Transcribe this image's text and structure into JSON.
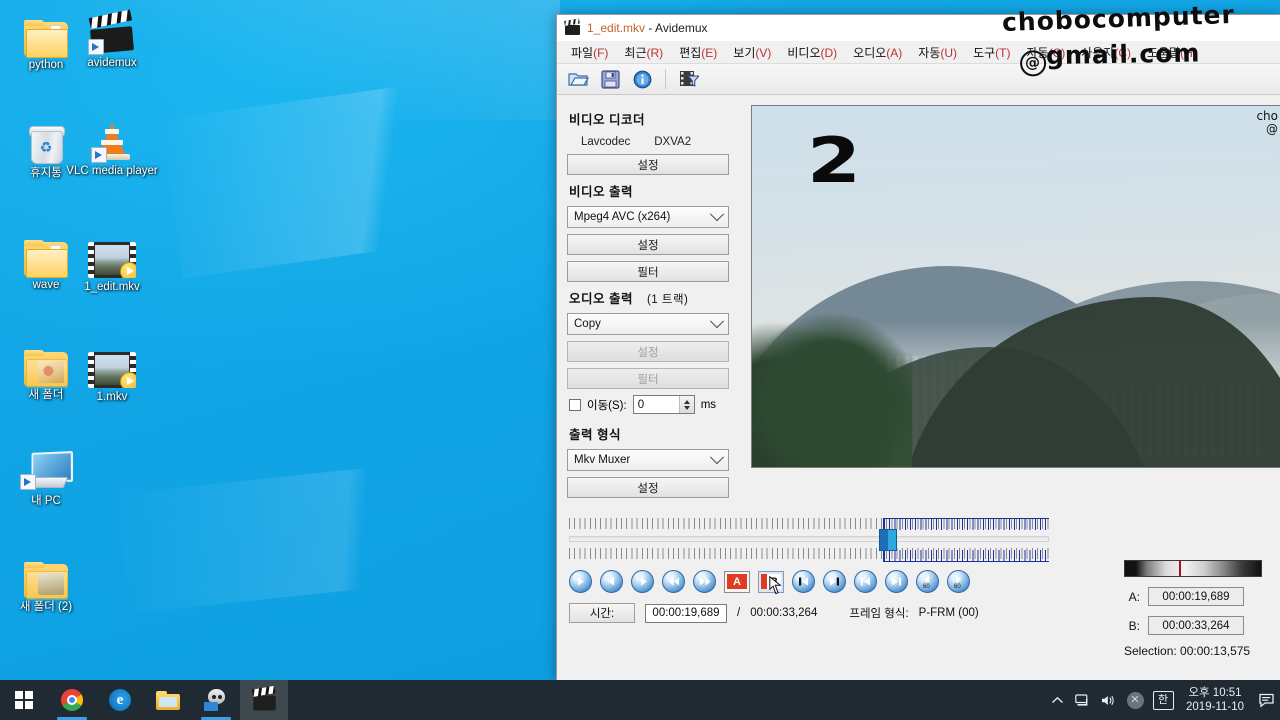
{
  "desktop": {
    "icons": [
      {
        "label": "python",
        "type": "folder"
      },
      {
        "label": "avidemux",
        "type": "clapper-shortcut"
      },
      {
        "label": "휴지통",
        "type": "recycle-bin"
      },
      {
        "label": "VLC media player",
        "type": "vlc-cone-shortcut"
      },
      {
        "label": "wave",
        "type": "folder"
      },
      {
        "label": "1_edit.mkv",
        "type": "video-file"
      },
      {
        "label": "새 폴더",
        "type": "folder-thumb"
      },
      {
        "label": "1.mkv",
        "type": "video-file"
      },
      {
        "label": "내 PC",
        "type": "my-computer-shortcut"
      },
      {
        "label": "새 폴더 (2)",
        "type": "folder-thumb"
      }
    ]
  },
  "taskbar": {
    "items": [
      {
        "name": "start",
        "label": "시작"
      },
      {
        "name": "chrome",
        "label": "Google Chrome"
      },
      {
        "name": "edge",
        "label": "Microsoft Edge"
      },
      {
        "name": "explorer",
        "label": "파일 탐색기"
      },
      {
        "name": "gimp",
        "label": "GIMP"
      },
      {
        "name": "avidemux",
        "label": "Avidemux"
      }
    ],
    "tray": {
      "ime": "한",
      "time": "오후 10:51",
      "date": "2019-11-10"
    }
  },
  "window": {
    "title_file": "1_edit.mkv",
    "title_sep": " - ",
    "title_app": "Avidemux",
    "menu": [
      {
        "label": "파일(F)",
        "text": "파일",
        "key": "(F)"
      },
      {
        "label": "최근(R)",
        "text": "최근",
        "key": "(R)"
      },
      {
        "label": "편집(E)",
        "text": "편집",
        "key": "(E)"
      },
      {
        "label": "보기(V)",
        "text": "보기",
        "key": "(V)"
      },
      {
        "label": "비디오(D)",
        "text": "비디오",
        "key": "(D)"
      },
      {
        "label": "오디오(A)",
        "text": "오디오",
        "key": "(A)"
      },
      {
        "label": "자동(U)",
        "text": "자동",
        "key": "(U)"
      },
      {
        "label": "도구(T)",
        "text": "도구",
        "key": "(T)"
      },
      {
        "label": "자동(C)",
        "text": "자동",
        "key": "(C)"
      },
      {
        "label": "사용자(C)",
        "text": "사용자",
        "key": "(C)"
      },
      {
        "label": "도움말(H)",
        "text": "도움말",
        "key": "(H)"
      }
    ],
    "toolbar": [
      {
        "name": "open-file-icon",
        "tip": "열기"
      },
      {
        "name": "save-file-icon",
        "tip": "저장"
      },
      {
        "name": "info-icon",
        "tip": "정보"
      },
      {
        "name": "filters-icon",
        "tip": "필터"
      }
    ]
  },
  "panel": {
    "video_decoder": {
      "heading": "비디오 디코더",
      "codec": "Lavcodec",
      "mode": "DXVA2",
      "config_label": "설정"
    },
    "video_output": {
      "heading": "비디오 출력",
      "codec": "Mpeg4 AVC (x264)",
      "config_label": "설정",
      "filter_label": "필터"
    },
    "audio_output": {
      "heading": "오디오 출력",
      "tracks": "(1 트랙)",
      "codec": "Copy",
      "config_label": "설정",
      "filter_label": "필터",
      "shift_label": "이동(S):",
      "shift_value": "0",
      "shift_unit": "ms"
    },
    "output_format": {
      "heading": "출력 형식",
      "muxer": "Mkv Muxer",
      "config_label": "설정"
    }
  },
  "preview": {
    "overlay_number": "2",
    "watermark_line1": "cho",
    "watermark_line2": "@"
  },
  "transport": {
    "buttons": [
      {
        "name": "play-button",
        "glyph": "play"
      },
      {
        "name": "prev-frame-button",
        "glyph": "left"
      },
      {
        "name": "next-frame-button",
        "glyph": "right"
      },
      {
        "name": "rewind-button",
        "glyph": "dleft"
      },
      {
        "name": "forward-button",
        "glyph": "dright"
      },
      {
        "name": "mark-a-button",
        "glyph": "A"
      },
      {
        "name": "mark-b-button",
        "glyph": "B"
      },
      {
        "name": "goto-prev-keyframe-button",
        "glyph": "kleft"
      },
      {
        "name": "goto-next-keyframe-button",
        "glyph": "kright"
      },
      {
        "name": "goto-start-button",
        "glyph": "start"
      },
      {
        "name": "goto-end-button",
        "glyph": "end"
      },
      {
        "name": "back-60s-button",
        "glyph": "b60"
      },
      {
        "name": "forward-60s-button",
        "glyph": "f60"
      }
    ],
    "mark_a_label": "A",
    "mark_b_label": "B"
  },
  "status": {
    "time_label": "시간:",
    "current_time": "00:00:19,689",
    "separator": "/",
    "total_time": "00:00:33,264",
    "frame_type_label": "프레임 형식:",
    "frame_type_value": "P-FRM (00)"
  },
  "selection": {
    "a_label": "A:",
    "a_value": "00:00:19,689",
    "b_label": "B:",
    "b_value": "00:00:33,264",
    "selection_text": "Selection: 00:00:13,575"
  },
  "handwriting": {
    "line1": "chobocomputer",
    "line2_at": "@",
    "line2": "gmail.com"
  },
  "colors": {
    "desktop": "#0fa2e4",
    "taskbar": "#1f2a33",
    "accent": "#3ca0e8",
    "marker_red": "#b10f20",
    "selection_blue": "#1b2ea8",
    "mark_a_red": "#e03a20"
  }
}
